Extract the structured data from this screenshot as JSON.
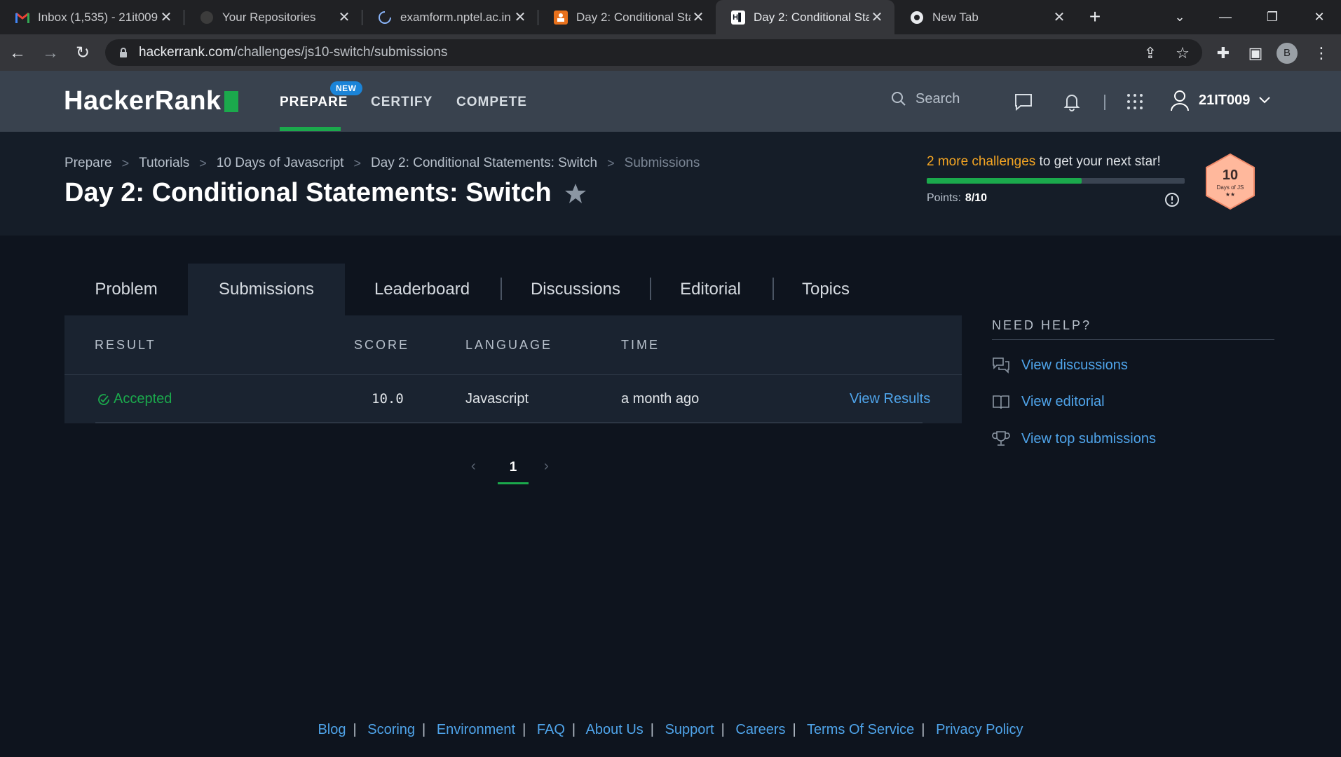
{
  "browser": {
    "tabs": [
      {
        "title": "Inbox (1,535) - 21it009",
        "icon": "gmail-icon"
      },
      {
        "title": "Your Repositories",
        "icon": "github-icon"
      },
      {
        "title": "examform.nptel.ac.in",
        "icon": "loading-icon"
      },
      {
        "title": "Day 2: Conditional Sta",
        "icon": "hackerrank-orange-icon"
      },
      {
        "title": "Day 2: Conditional Sta",
        "icon": "hackerrank-icon"
      },
      {
        "title": "New Tab",
        "icon": "chrome-icon"
      }
    ],
    "url_host": "hackerrank.com",
    "url_path": "/challenges/js10-switch/submissions",
    "profile_initial": "B"
  },
  "nav": {
    "logo": "HackerRank",
    "items": [
      "PREPARE",
      "CERTIFY",
      "COMPETE"
    ],
    "new_badge": "NEW",
    "search_placeholder": "Search",
    "username": "21IT009"
  },
  "header": {
    "breadcrumb": [
      "Prepare",
      "Tutorials",
      "10 Days of Javascript",
      "Day 2: Conditional Statements: Switch",
      "Submissions"
    ],
    "title": "Day 2: Conditional Statements: Switch",
    "progress_highlight": "2 more challenges",
    "progress_rest": " to get your next star!",
    "points_label": "Points:",
    "points_value": "8/10",
    "progress_fraction": 0.6,
    "badge_number": "10",
    "badge_text": "Days of JS"
  },
  "tabs": [
    "Problem",
    "Submissions",
    "Leaderboard",
    "Discussions",
    "Editorial",
    "Topics"
  ],
  "table": {
    "headers": [
      "RESULT",
      "SCORE",
      "LANGUAGE",
      "TIME"
    ],
    "rows": [
      {
        "result": "Accepted",
        "score": "10.0",
        "language": "Javascript",
        "time": "a month ago",
        "action": "View Results"
      }
    ]
  },
  "pagination": {
    "current": "1"
  },
  "help": {
    "title": "NEED HELP?",
    "links": [
      "View discussions",
      "View editorial",
      "View top submissions"
    ]
  },
  "footer": [
    "Blog",
    "Scoring",
    "Environment",
    "FAQ",
    "About Us",
    "Support",
    "Careers",
    "Terms Of Service",
    "Privacy Policy"
  ],
  "colors": {
    "accent_green": "#1ba94c",
    "link_blue": "#4fa4ea",
    "highlight_orange": "#f5a623"
  }
}
